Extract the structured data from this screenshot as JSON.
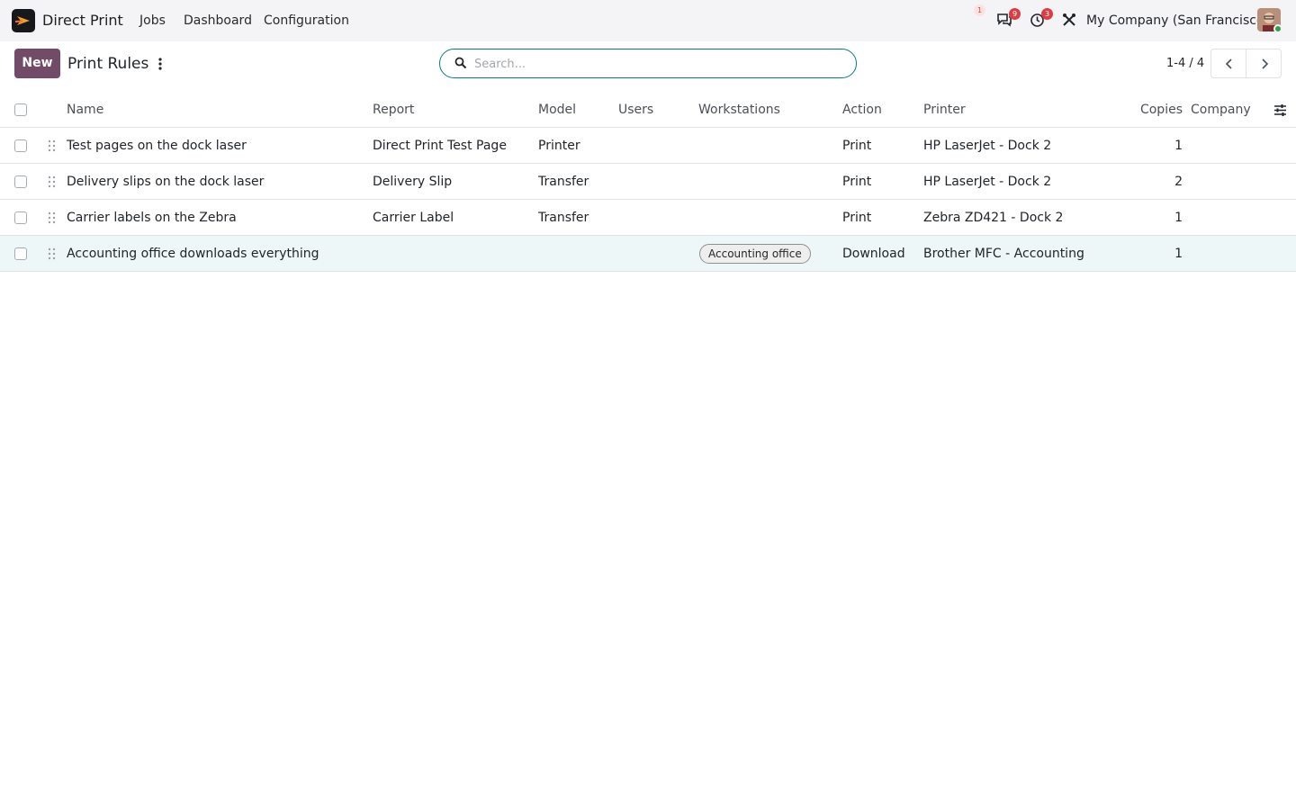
{
  "navbar": {
    "app_name": "Direct Print",
    "menus": [
      "Jobs",
      "Dashboard",
      "Configuration"
    ],
    "badges": {
      "first": "1",
      "messages": "9",
      "activities": "3"
    },
    "company": "My Company (San Francisco)"
  },
  "control_panel": {
    "new_label": "New",
    "title": "Print Rules",
    "search_placeholder": "Search...",
    "pager": "1-4 / 4"
  },
  "table": {
    "columns": [
      "Name",
      "Report",
      "Model",
      "Users",
      "Workstations",
      "Action",
      "Printer",
      "Copies",
      "Company"
    ],
    "rows": [
      {
        "name": "Test pages on the dock laser",
        "report": "Direct Print Test Page",
        "model": "Printer",
        "users": "",
        "workstations": "",
        "action": "Print",
        "printer": "HP LaserJet - Dock 2",
        "copies": "1",
        "company": ""
      },
      {
        "name": "Delivery slips on the dock laser",
        "report": "Delivery Slip",
        "model": "Transfer",
        "users": "",
        "workstations": "",
        "action": "Print",
        "printer": "HP LaserJet - Dock 2",
        "copies": "2",
        "company": ""
      },
      {
        "name": "Carrier labels on the Zebra",
        "report": "Carrier Label",
        "model": "Transfer",
        "users": "",
        "workstations": "",
        "action": "Print",
        "printer": "Zebra ZD421 - Dock 2",
        "copies": "1",
        "company": ""
      },
      {
        "name": "Accounting office downloads everything",
        "report": "",
        "model": "",
        "users": "",
        "workstations": "Accounting office",
        "action": "Download",
        "printer": "Brother MFC - Accounting",
        "copies": "1",
        "company": ""
      }
    ]
  },
  "colors": {
    "brand": "#714b67",
    "accent": "#017e84",
    "badge": "#dc3d43",
    "navbar": "#f4f4f6"
  },
  "icons": [
    "app-logo-icon",
    "chat-icon",
    "clock-icon",
    "tools-icon",
    "search-icon",
    "kebab-icon",
    "chevron-left-icon",
    "chevron-right-icon",
    "drag-handle-icon",
    "optional-columns-icon"
  ]
}
